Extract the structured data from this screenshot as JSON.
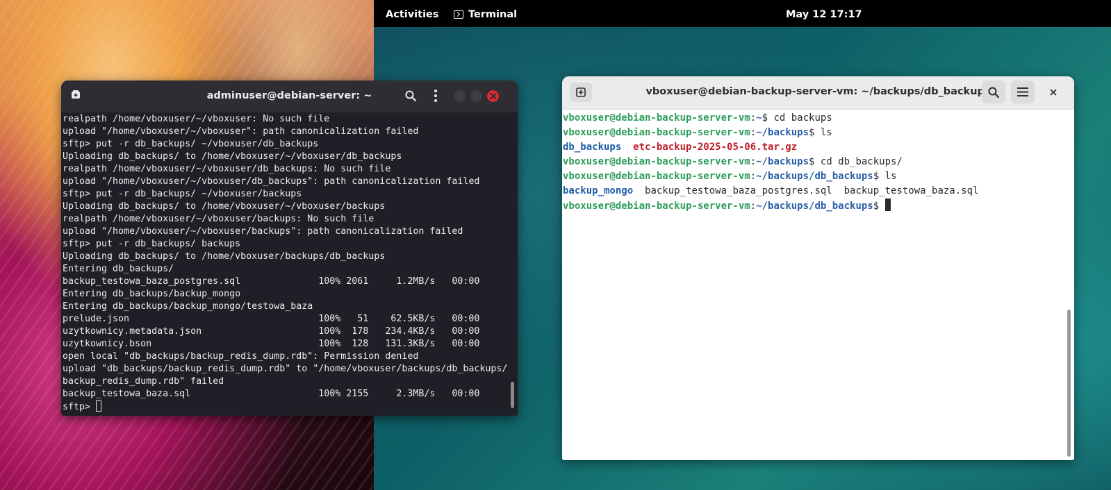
{
  "topbar": {
    "activities": "Activities",
    "app_name": "Terminal",
    "clock": "May 12  17:17"
  },
  "left_terminal": {
    "title": "adminuser@debian-server: ~",
    "lines": [
      "realpath /home/vboxuser/~/vboxuser: No such file",
      "upload \"/home/vboxuser/~/vboxuser\": path canonicalization failed",
      "sftp> put -r db_backups/ ~/vboxuser/db_backups",
      "Uploading db_backups/ to /home/vboxuser/~/vboxuser/db_backups",
      "realpath /home/vboxuser/~/vboxuser/db_backups: No such file",
      "upload \"/home/vboxuser/~/vboxuser/db_backups\": path canonicalization failed",
      "sftp> put -r db_backups/ ~/vboxuser/backups",
      "Uploading db_backups/ to /home/vboxuser/~/vboxuser/backups",
      "realpath /home/vboxuser/~/vboxuser/backups: No such file",
      "upload \"/home/vboxuser/~/vboxuser/backups\": path canonicalization failed",
      "sftp> put -r db_backups/ backups",
      "Uploading db_backups/ to /home/vboxuser/backups/db_backups",
      "Entering db_backups/",
      "backup_testowa_baza_postgres.sql              100% 2061     1.2MB/s   00:00",
      "Entering db_backups/backup_mongo",
      "Entering db_backups/backup_mongo/testowa_baza",
      "prelude.json                                  100%   51    62.5KB/s   00:00",
      "uzytkownicy.metadata.json                     100%  178   234.4KB/s   00:00",
      "uzytkownicy.bson                              100%  128   131.3KB/s   00:00",
      "open local \"db_backups/backup_redis_dump.rdb\": Permission denied",
      "upload \"db_backups/backup_redis_dump.rdb\" to \"/home/vboxuser/backups/db_backups/",
      "backup_redis_dump.rdb\" failed",
      "backup_testowa_baza.sql                       100% 2155     2.3MB/s   00:00"
    ],
    "prompt": "sftp> "
  },
  "right_terminal": {
    "title": "vboxuser@debian-backup-server-vm: ~/backups/db_backups",
    "user_host": "vboxuser@debian-backup-server-vm",
    "line1_path": "~",
    "line1_cmd": "$ cd backups",
    "line2_path": "~/backups",
    "line2_cmd": "$ ls",
    "ls1_dir": "db_backups",
    "ls1_archive": "etc-backup-2025-05-06.tar.gz",
    "line4_path": "~/backups",
    "line4_cmd": "$ cd db_backups/",
    "line5_path": "~/backups/db_backups",
    "line5_cmd": "$ ls",
    "ls2_dir": "backup_mongo",
    "ls2_files": "backup_testowa_baza_postgres.sql  backup_testowa_baza.sql",
    "line7_path": "~/backups/db_backups",
    "line7_cmd": "$ "
  },
  "colors": {
    "prompt_user": "#2e9e5b",
    "prompt_path": "#2a5fa6",
    "ls_archive": "#c01c28",
    "close_button": "#d92a2f"
  },
  "icons": {
    "new_tab": "new-tab-icon",
    "search": "search-icon",
    "menu": "hamburger-menu-icon",
    "kebab": "kebab-menu-icon",
    "close": "close-icon",
    "terminal": "terminal-icon"
  }
}
